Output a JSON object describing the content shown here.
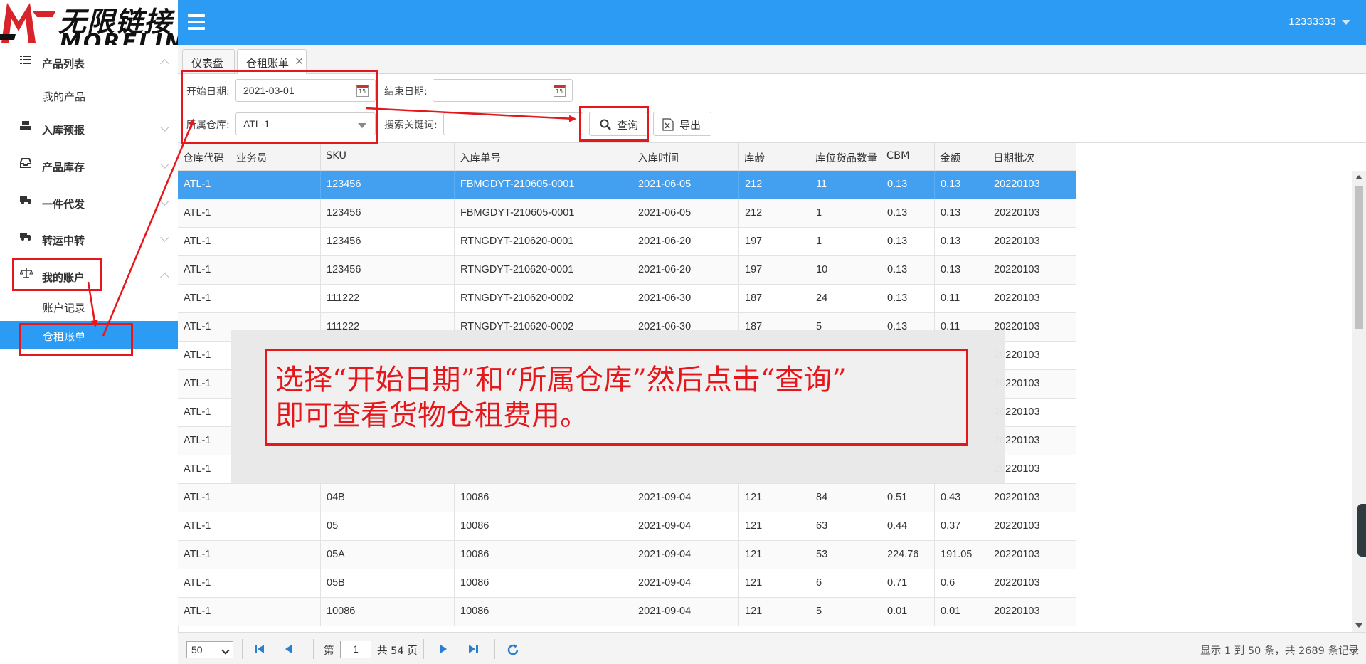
{
  "brand": {
    "name_cn": "无限链接",
    "name_en": "MORELINK",
    "accent": "#2b9bf4",
    "annotation_color": "#e6161a"
  },
  "header": {
    "user_name": "12333333"
  },
  "sidebar": {
    "groups": [
      {
        "label": "产品列表",
        "icon": "list-icon",
        "expanded": true,
        "items": [
          "我的产品"
        ]
      },
      {
        "label": "入库预报",
        "icon": "inbound-icon",
        "expanded": false
      },
      {
        "label": "产品库存",
        "icon": "inbox-icon",
        "expanded": false
      },
      {
        "label": "一件代发",
        "icon": "truck-icon",
        "expanded": false
      },
      {
        "label": "转运中转",
        "icon": "truck-icon",
        "expanded": false
      },
      {
        "label": "我的账户",
        "icon": "scale-icon",
        "expanded": true,
        "items": [
          "账户记录",
          "仓租账单"
        ]
      }
    ],
    "active_item": "仓租账单"
  },
  "tabs": [
    {
      "label": "仪表盘",
      "active": false,
      "closable": false
    },
    {
      "label": "仓租账单",
      "active": true,
      "closable": true
    }
  ],
  "filter": {
    "start_date_label": "开始日期:",
    "start_date_value": "2021-03-01",
    "end_date_label": "结束日期:",
    "end_date_value": "",
    "warehouse_label": "所属仓库:",
    "warehouse_value": "ATL-1",
    "keyword_label": "搜索关键词:",
    "keyword_value": "",
    "query_button": "查询",
    "export_button": "导出"
  },
  "table": {
    "columns": [
      "仓库代码",
      "业务员",
      "SKU",
      "入库单号",
      "入库时间",
      "库龄",
      "库位货品数量",
      "CBM",
      "金额",
      "日期批次"
    ],
    "rows": [
      [
        "ATL-1",
        "",
        "123456",
        "FBMGDYT-210605-0001",
        "2021-06-05",
        "212",
        "11",
        "0.13",
        "0.13",
        "20220103"
      ],
      [
        "ATL-1",
        "",
        "123456",
        "FBMGDYT-210605-0001",
        "2021-06-05",
        "212",
        "1",
        "0.13",
        "0.13",
        "20220103"
      ],
      [
        "ATL-1",
        "",
        "123456",
        "RTNGDYT-210620-0001",
        "2021-06-20",
        "197",
        "1",
        "0.13",
        "0.13",
        "20220103"
      ],
      [
        "ATL-1",
        "",
        "123456",
        "RTNGDYT-210620-0001",
        "2021-06-20",
        "197",
        "10",
        "0.13",
        "0.13",
        "20220103"
      ],
      [
        "ATL-1",
        "",
        "111222",
        "RTNGDYT-210620-0002",
        "2021-06-30",
        "187",
        "24",
        "0.13",
        "0.11",
        "20220103"
      ],
      [
        "ATL-1",
        "",
        "111222",
        "RTNGDYT-210620-0002",
        "2021-06-30",
        "187",
        "5",
        "0.13",
        "0.11",
        "20220103"
      ],
      [
        "ATL-1",
        "",
        "",
        "",
        "",
        "",
        "",
        "",
        "",
        "20220103"
      ],
      [
        "ATL-1",
        "",
        "",
        "",
        "",
        "",
        "",
        "",
        "",
        "20220103"
      ],
      [
        "ATL-1",
        "",
        "",
        "",
        "",
        "",
        "",
        "",
        "",
        "20220103"
      ],
      [
        "ATL-1",
        "",
        "",
        "",
        "",
        "",
        "",
        "",
        "",
        "20220103"
      ],
      [
        "ATL-1",
        "",
        "",
        "",
        "",
        "",
        "",
        "",
        "",
        "20220103"
      ],
      [
        "ATL-1",
        "",
        "04B",
        "10086",
        "2021-09-04",
        "121",
        "84",
        "0.51",
        "0.43",
        "20220103"
      ],
      [
        "ATL-1",
        "",
        "05",
        "10086",
        "2021-09-04",
        "121",
        "63",
        "0.44",
        "0.37",
        "20220103"
      ],
      [
        "ATL-1",
        "",
        "05A",
        "10086",
        "2021-09-04",
        "121",
        "53",
        "224.76",
        "191.05",
        "20220103"
      ],
      [
        "ATL-1",
        "",
        "05B",
        "10086",
        "2021-09-04",
        "121",
        "6",
        "0.71",
        "0.6",
        "20220103"
      ],
      [
        "ATL-1",
        "",
        "10086",
        "10086",
        "2021-09-04",
        "121",
        "5",
        "0.01",
        "0.01",
        "20220103"
      ]
    ],
    "selected_row": 0
  },
  "annotation": {
    "line1": "选择“开始日期”和“所属仓库”然后点击“查询”",
    "line2": "即可查看货物仓租费用。"
  },
  "pager": {
    "page_size": "50",
    "page_prefix": "第",
    "current_page": "1",
    "page_suffix": "共 54 页",
    "info": "显示 1 到 50 条，共 2689 条记录"
  }
}
